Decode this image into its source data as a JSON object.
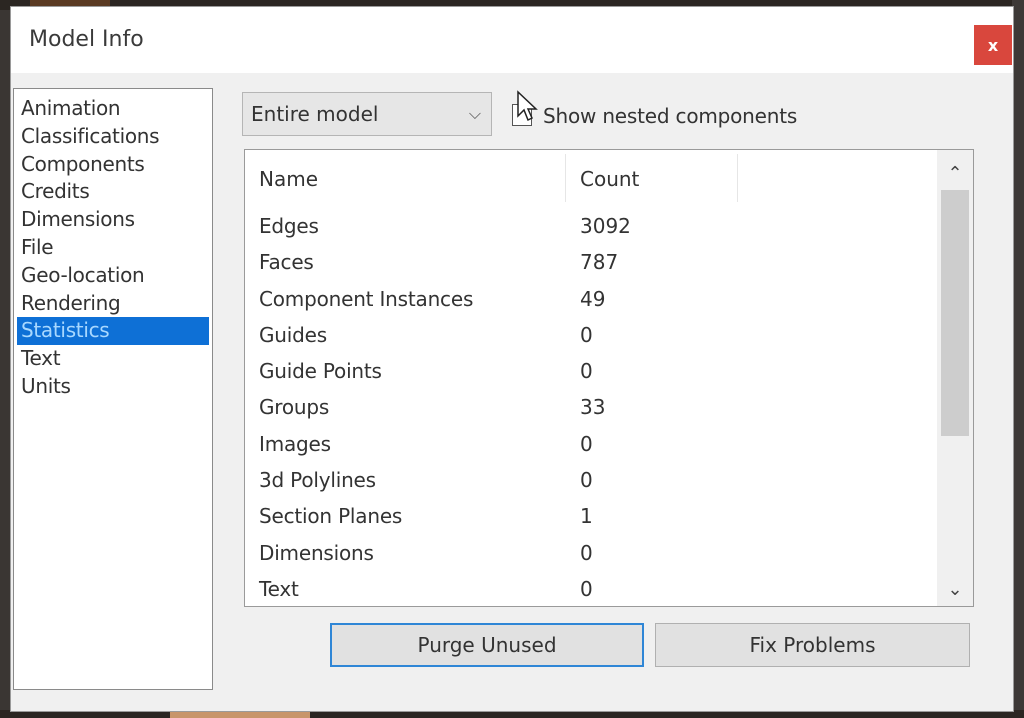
{
  "dialog": {
    "title": "Model Info",
    "close_label": "x"
  },
  "nav": {
    "items": [
      {
        "label": "Animation",
        "selected": false
      },
      {
        "label": "Classifications",
        "selected": false
      },
      {
        "label": "Components",
        "selected": false
      },
      {
        "label": "Credits",
        "selected": false
      },
      {
        "label": "Dimensions",
        "selected": false
      },
      {
        "label": "File",
        "selected": false
      },
      {
        "label": "Geo-location",
        "selected": false
      },
      {
        "label": "Rendering",
        "selected": false
      },
      {
        "label": "Statistics",
        "selected": true
      },
      {
        "label": "Text",
        "selected": false
      },
      {
        "label": "Units",
        "selected": false
      }
    ]
  },
  "scope_select": {
    "value": "Entire model",
    "chevron": "⌵"
  },
  "nested_components": {
    "label": "Show nested components",
    "checked": false
  },
  "stats_table": {
    "headers": {
      "name": "Name",
      "count": "Count"
    },
    "rows": [
      {
        "name": "Edges",
        "count": "3092"
      },
      {
        "name": "Faces",
        "count": "787"
      },
      {
        "name": "Component Instances",
        "count": "49"
      },
      {
        "name": "Guides",
        "count": "0"
      },
      {
        "name": "Guide Points",
        "count": "0"
      },
      {
        "name": "Groups",
        "count": "33"
      },
      {
        "name": "Images",
        "count": "0"
      },
      {
        "name": "3d Polylines",
        "count": "0"
      },
      {
        "name": "Section Planes",
        "count": "1"
      },
      {
        "name": "Dimensions",
        "count": "0"
      },
      {
        "name": "Text",
        "count": "0"
      }
    ],
    "scroll_up": "⌃",
    "scroll_down": "⌄"
  },
  "buttons": {
    "purge": "Purge Unused",
    "fix": "Fix Problems"
  },
  "colors": {
    "selection": "#0e70d6",
    "close": "#d9473d",
    "focus_border": "#2f86d6"
  }
}
